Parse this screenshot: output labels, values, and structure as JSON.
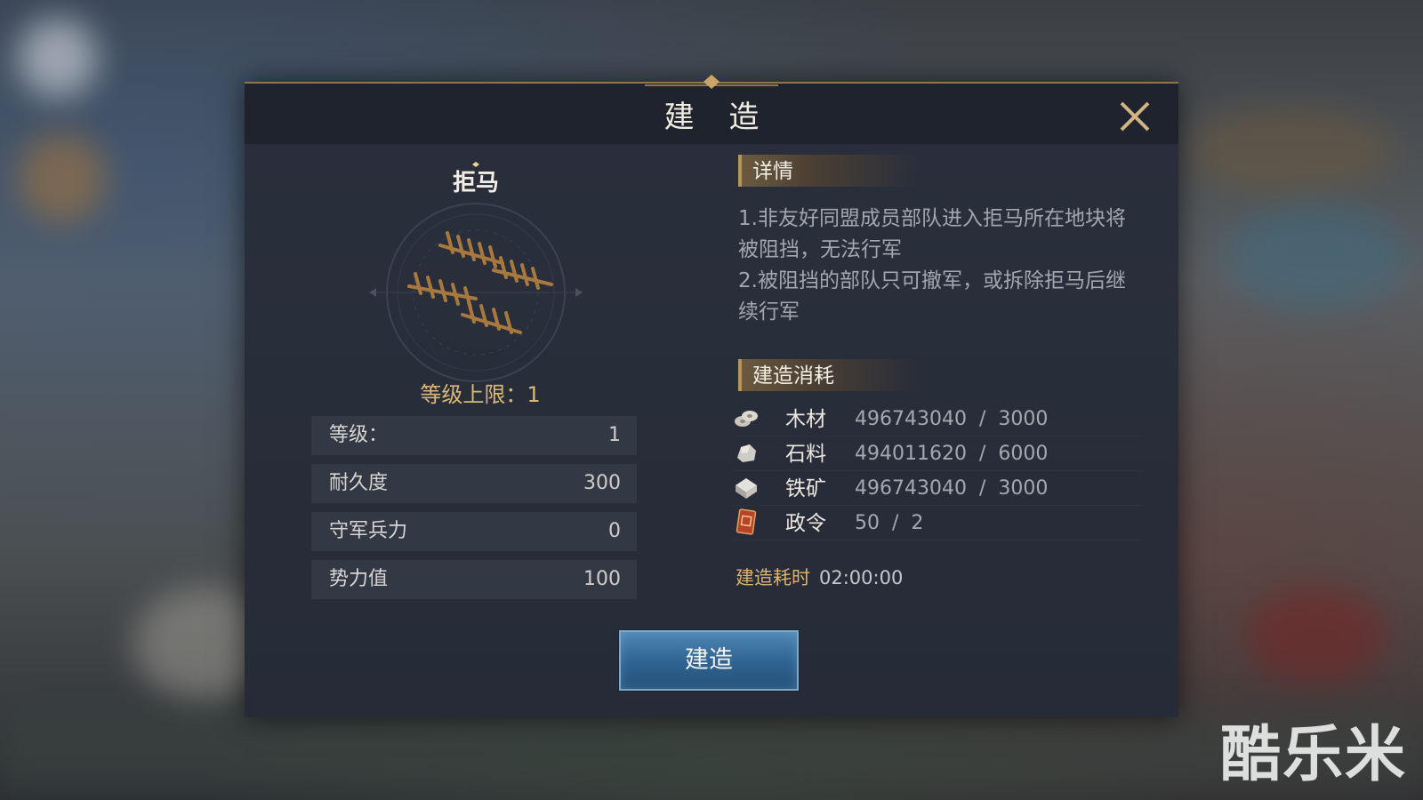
{
  "dialog": {
    "title": "建 造",
    "close_icon": "close-icon"
  },
  "building": {
    "name": "拒马",
    "icon": "barricade-fence-icon",
    "level_cap": "等级上限：1"
  },
  "stats": [
    {
      "label": "等级：",
      "value": "1"
    },
    {
      "label": "耐久度",
      "value": "300"
    },
    {
      "label": "守军兵力",
      "value": "0"
    },
    {
      "label": "势力值",
      "value": "100"
    }
  ],
  "details": {
    "heading": "详情",
    "line1": "1.非友好同盟成员部队进入拒马所在地块将被阻挡，无法行军",
    "line2": "2.被阻挡的部队只可撤军，或拆除拒马后继续行军"
  },
  "costs": {
    "heading": "建造消耗",
    "items": [
      {
        "icon": "wood-icon",
        "name": "木材",
        "value": "496743040  /  3000"
      },
      {
        "icon": "stone-icon",
        "name": "石料",
        "value": "494011620  /  6000"
      },
      {
        "icon": "iron-ore-icon",
        "name": "铁矿",
        "value": "496743040  /  3000"
      },
      {
        "icon": "decree-icon",
        "name": "政令",
        "value": "50  /  2"
      }
    ]
  },
  "build_time": {
    "label": "建造耗时",
    "value": "02:00:00"
  },
  "build_button": {
    "label": "建造"
  },
  "watermark": "酷乐米",
  "colors": {
    "gold_text": "#dcb874",
    "button_blue": "#2f6391",
    "panel_bg": "#262b37"
  }
}
